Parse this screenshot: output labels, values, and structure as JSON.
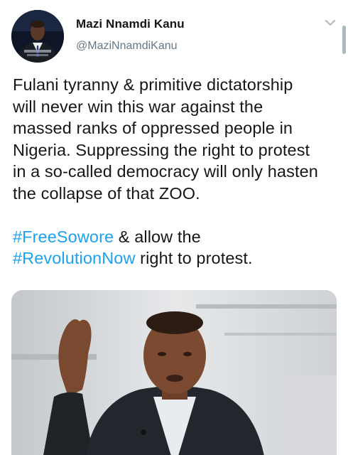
{
  "tweet": {
    "author_name": "Mazi Nnamdi Kanu",
    "author_handle": "@MaziNnamdiKanu",
    "text_lines": [
      "Fulani tyranny & primitive dictatorship",
      "will never win this war against the",
      "massed ranks of oppressed people in",
      "Nigeria. Suppressing the right to protest",
      "in a so-called democracy will only hasten",
      "the collapse of that ZOO."
    ],
    "line7_hashtag": "#FreeSowore",
    "line7_rest": " & allow the",
    "line8_hashtag": "#RevolutionNow",
    "line8_rest": " right to protest."
  },
  "icons": {
    "menu": "chevron-down-icon"
  },
  "colors": {
    "link": "#1da1f2",
    "text": "#14171a",
    "secondary": "#657786"
  }
}
